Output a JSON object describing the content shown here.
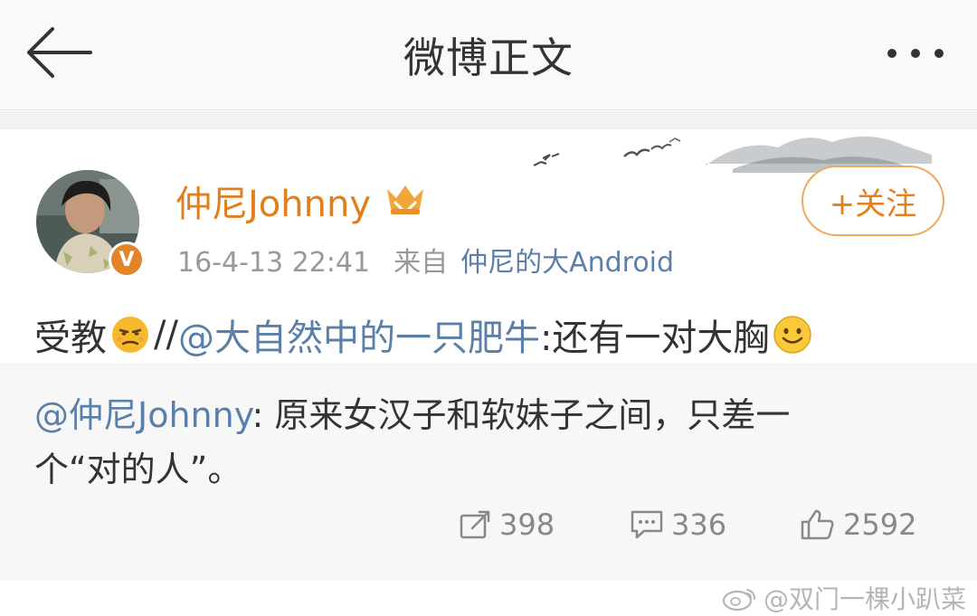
{
  "header": {
    "title": "微博正文",
    "back_icon": "back-arrow-icon",
    "more_icon": "more-dots-icon"
  },
  "post": {
    "author": "仲尼Johnny",
    "verified_badge": "V",
    "timestamp": "16-4-13 22:41",
    "source_label": "来自",
    "source_client": "仲尼的大Android",
    "follow_label": "+关注",
    "text_prefix": "受教",
    "repost_sep": "//",
    "mention": "@大自然中的一只肥牛",
    "text_suffix": ":还有一对大胸"
  },
  "retweet": {
    "mention": "@仲尼Johnny",
    "text": ": 原来女汉子和软妹子之间，只差一个“对的人”。"
  },
  "actions": {
    "repost_count": "398",
    "comment_count": "336",
    "like_count": "2592"
  },
  "watermark": "@双门一棵小趴菜",
  "colors": {
    "username": "#e07f1c",
    "link": "#5a7fa8",
    "follow_border": "#f0a85a"
  }
}
